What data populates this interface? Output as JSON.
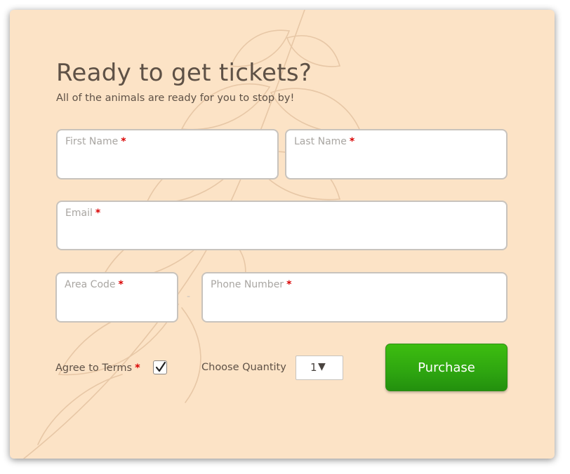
{
  "form": {
    "title": "Ready to get tickets?",
    "subtitle": "All of the animals are ready for you to stop by!",
    "required_marker": "*",
    "fields": {
      "first_name": {
        "label": "First Name",
        "value": ""
      },
      "last_name": {
        "label": "Last Name",
        "value": ""
      },
      "email": {
        "label": "Email",
        "value": ""
      },
      "area_code": {
        "label": "Area Code",
        "value": ""
      },
      "phone_number": {
        "label": "Phone Number",
        "value": ""
      }
    },
    "phone_separator": "-",
    "terms": {
      "label": "Agree to Terms",
      "checked": true
    },
    "quantity": {
      "label": "Choose Quantity",
      "selected": "1",
      "arrow": "▼"
    },
    "purchase_label": "Purchase"
  },
  "colors": {
    "background": "#fce3c6",
    "text": "#5e5146",
    "required": "#d90000",
    "button": "#2ea510"
  }
}
